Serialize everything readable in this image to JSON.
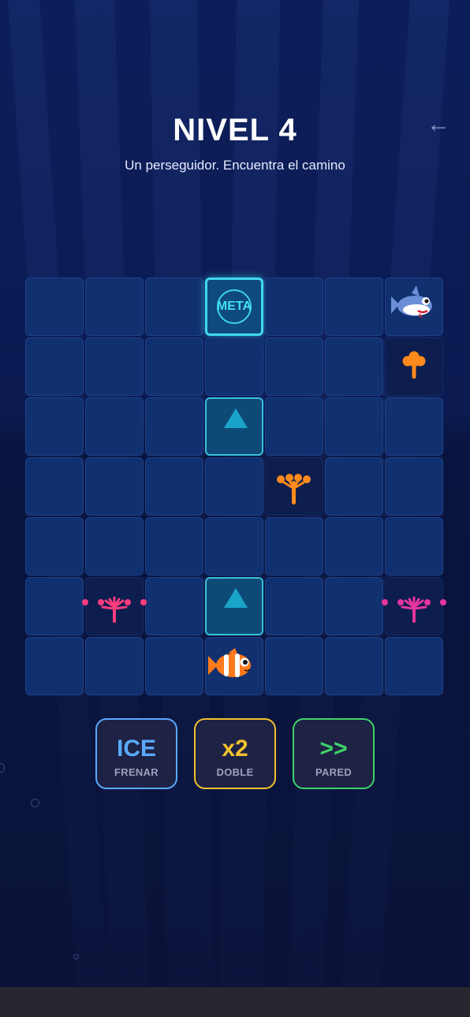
{
  "level": {
    "title": "NIVEL 4",
    "subtitle": "Un perseguidor. Encuentra el camino"
  },
  "nav": {
    "back_icon": "back-arrow-icon",
    "back_glyph": "←"
  },
  "board": {
    "rows": 7,
    "cols": 7,
    "goal": {
      "row": 0,
      "col": 3,
      "label": "META"
    },
    "arrow_tiles": [
      {
        "row": 2,
        "col": 3,
        "direction": "up"
      },
      {
        "row": 5,
        "col": 3,
        "direction": "up"
      }
    ],
    "player": {
      "row": 6,
      "col": 3,
      "icon": "clownfish-icon"
    },
    "chaser": {
      "row": 0,
      "col": 6,
      "icon": "shark-icon"
    },
    "obstacles": [
      {
        "row": 1,
        "col": 6,
        "icon": "orange-coral-icon"
      },
      {
        "row": 3,
        "col": 4,
        "icon": "orange-coral-icon"
      },
      {
        "row": 5,
        "col": 1,
        "icon": "pink-anemone-icon"
      },
      {
        "row": 5,
        "col": 6,
        "icon": "pink-anemone-icon"
      }
    ]
  },
  "powerups": [
    {
      "symbol": "ICE",
      "label": "FRENAR",
      "color": "#5aa9ff"
    },
    {
      "symbol": "x2",
      "label": "DOBLE",
      "color": "#f2c12e"
    },
    {
      "symbol": ">>",
      "label": "PARED",
      "color": "#3ed36a"
    }
  ]
}
